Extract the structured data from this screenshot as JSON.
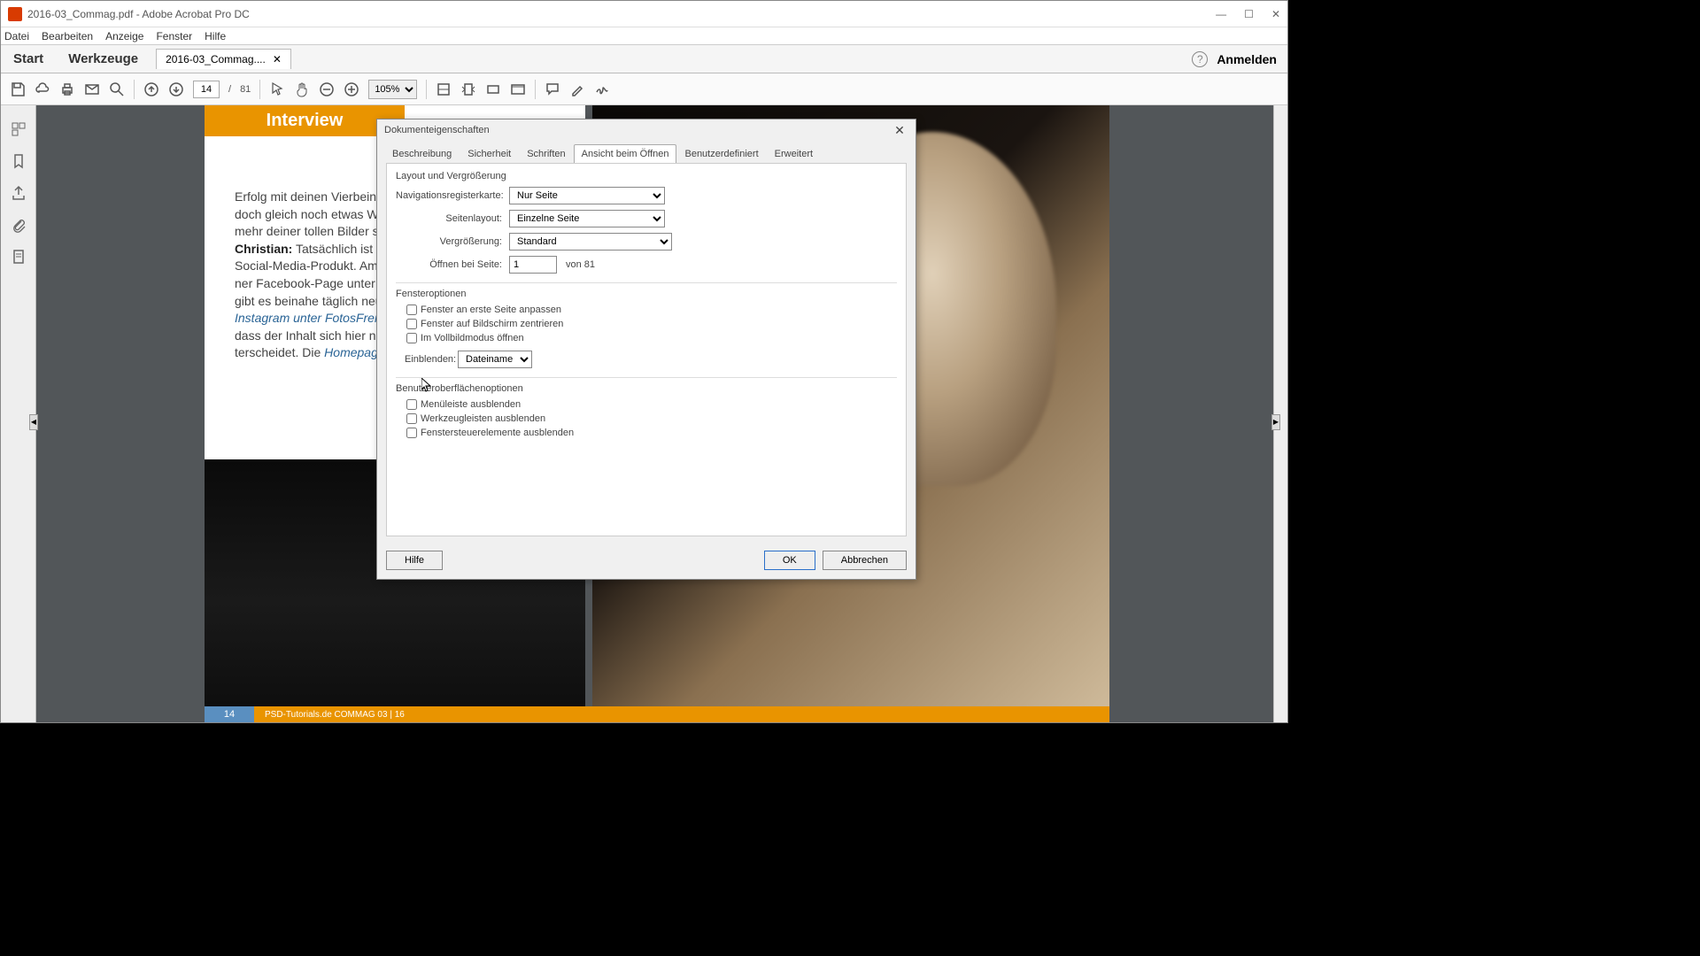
{
  "titlebar": {
    "text": "2016-03_Commag.pdf - Adobe Acrobat Pro DC"
  },
  "win_controls": {
    "min": "—",
    "max": "☐",
    "close": "✕"
  },
  "menubar": [
    "Datei",
    "Bearbeiten",
    "Anzeige",
    "Fenster",
    "Hilfe"
  ],
  "tabs": {
    "start": "Start",
    "tools": "Werkzeuge",
    "doc": "2016-03_Commag....",
    "signin": "Anmelden"
  },
  "toolbar": {
    "page_current": "14",
    "page_sep": "/",
    "page_total": "81",
    "zoom": "105%"
  },
  "page": {
    "interview": "Interview",
    "body_lines": [
      "Erfolg mit deinen Vierbeine",
      "doch gleich noch etwas W",
      "mehr deiner tollen Bilder s"
    ],
    "christian_label": "Christian:",
    "christian_text": " Tatsächlich ist „F",
    "lines2": [
      "Social-Media-Produkt. Am a",
      "ner  Facebook-Page  unter",
      "gibt es beinahe täglich neu"
    ],
    "link1": "Instagram  unter  FotosFreiS",
    "lines3": "dass der Inhalt sich hier nic",
    "lines4_pre": "terscheidet. Die ",
    "link2": "Homepage",
    "footer_num": "14",
    "footer_text": "PSD-Tutorials.de   COMMAG 03 | 16"
  },
  "dialog": {
    "title": "Dokumenteigenschaften",
    "tabs": [
      "Beschreibung",
      "Sicherheit",
      "Schriften",
      "Ansicht beim Öffnen",
      "Benutzerdefiniert",
      "Erweitert"
    ],
    "active_tab": 3,
    "group1": "Layout und Vergrößerung",
    "nav_label": "Navigationsregisterkarte:",
    "nav_value": "Nur Seite",
    "layout_label": "Seitenlayout:",
    "layout_value": "Einzelne Seite",
    "mag_label": "Vergrößerung:",
    "mag_value": "Standard",
    "open_label": "Öffnen bei Seite:",
    "open_value": "1",
    "open_of": "von 81",
    "group2": "Fensteroptionen",
    "cb1": "Fenster an erste Seite anpassen",
    "cb2": "Fenster auf Bildschirm zentrieren",
    "cb3": "Im Vollbildmodus öffnen",
    "show_label": "Einblenden:",
    "show_value": "Dateiname",
    "group3": "Benutzeroberflächenoptionen",
    "cb4": "Menüleiste ausblenden",
    "cb5": "Werkzeugleisten ausblenden",
    "cb6": "Fenstersteuerelemente ausblenden",
    "help": "Hilfe",
    "ok": "OK",
    "cancel": "Abbrechen"
  }
}
